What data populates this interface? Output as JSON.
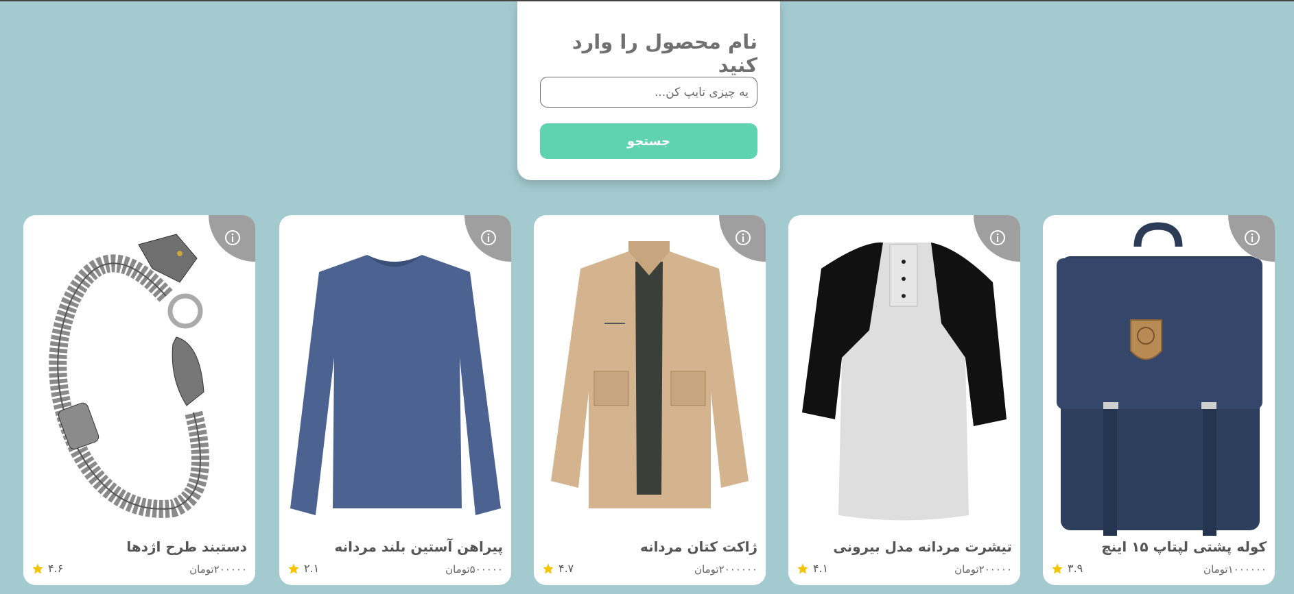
{
  "search": {
    "title": "نام محصول را وارد کنید",
    "placeholder": "یه چیزی تایپ کن...",
    "button_label": "جستجو"
  },
  "products": [
    {
      "title": "کوله پشتی لپتاپ ۱۵ اینچ",
      "price": "۱۰۰۰۰۰۰تومان",
      "rating": "۳.۹",
      "image": "backpack-image"
    },
    {
      "title": "تیشرت مردانه مدل بیرونی",
      "price": "۲۰۰۰۰۰تومان",
      "rating": "۴.۱",
      "image": "raglan-shirt-image"
    },
    {
      "title": "ژاکت کتان مردانه",
      "price": "۲۰۰۰۰۰۰تومان",
      "rating": "۴.۷",
      "image": "jacket-image"
    },
    {
      "title": "پیراهن آستین بلند مردانه",
      "price": "۵۰۰۰۰۰تومان",
      "rating": "۲.۱",
      "image": "longsleeve-shirt-image"
    },
    {
      "title": "دستبند طرح اژدها",
      "price": "۲۰۰۰۰۰تومان",
      "rating": "۴.۶",
      "image": "dragon-bracelet-image"
    }
  ],
  "colors": {
    "background": "#a3cbcf",
    "accent": "#5fd3af",
    "star": "#f5c400"
  }
}
